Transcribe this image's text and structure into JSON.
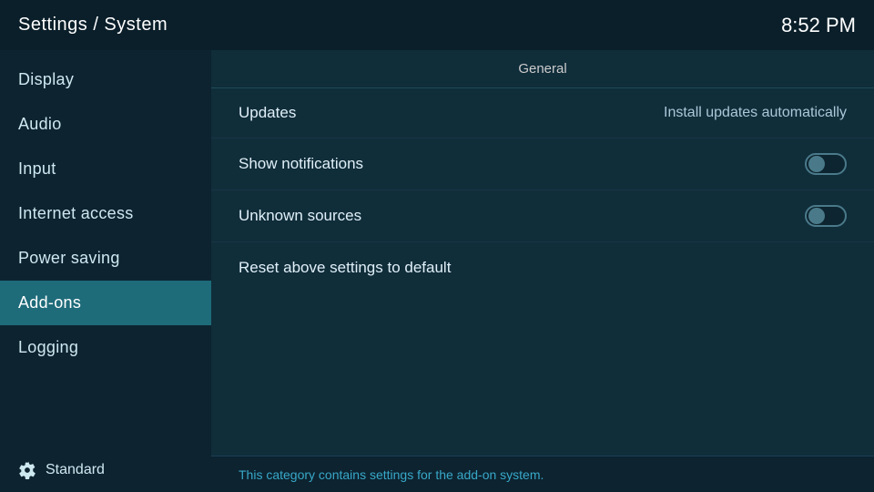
{
  "header": {
    "title": "Settings / System",
    "time": "8:52 PM"
  },
  "sidebar": {
    "items": [
      {
        "id": "display",
        "label": "Display",
        "active": false
      },
      {
        "id": "audio",
        "label": "Audio",
        "active": false
      },
      {
        "id": "input",
        "label": "Input",
        "active": false
      },
      {
        "id": "internet-access",
        "label": "Internet access",
        "active": false
      },
      {
        "id": "power-saving",
        "label": "Power saving",
        "active": false
      },
      {
        "id": "add-ons",
        "label": "Add-ons",
        "active": true
      },
      {
        "id": "logging",
        "label": "Logging",
        "active": false
      }
    ],
    "footer": {
      "label": "Standard",
      "icon": "gear"
    }
  },
  "content": {
    "section_label": "General",
    "settings": [
      {
        "id": "updates",
        "label": "Updates",
        "type": "value",
        "value": "Install updates automatically",
        "toggle": null
      },
      {
        "id": "show-notifications",
        "label": "Show notifications",
        "type": "toggle",
        "value": null,
        "toggle": false
      },
      {
        "id": "unknown-sources",
        "label": "Unknown sources",
        "type": "toggle",
        "value": null,
        "toggle": false
      }
    ],
    "reset_label": "Reset above settings to default"
  },
  "statusbar": {
    "text": "This category contains settings for the add-on system."
  }
}
